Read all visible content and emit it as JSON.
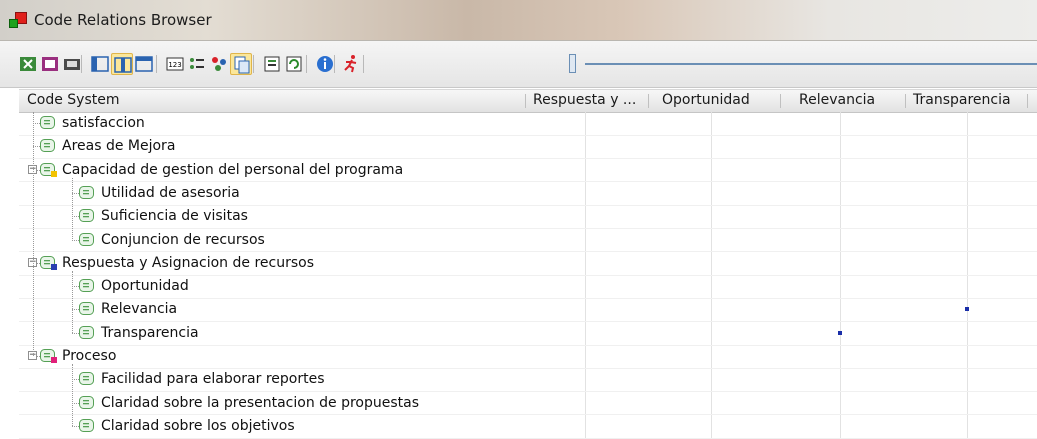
{
  "window": {
    "title": "Code Relations Browser"
  },
  "toolbar": {
    "buttons": [
      {
        "icon": "export-excel-icon"
      },
      {
        "icon": "export-icon"
      },
      {
        "icon": "print-icon"
      },
      {
        "icon": "layout-left-icon"
      },
      {
        "icon": "layout-center-icon",
        "active": true
      },
      {
        "icon": "layout-right-icon"
      },
      {
        "icon": "numbers-icon"
      },
      {
        "icon": "list-icon"
      },
      {
        "icon": "codes-icon"
      },
      {
        "icon": "copy-icon",
        "active": true
      },
      {
        "icon": "settings-list-icon"
      },
      {
        "icon": "refresh-icon"
      },
      {
        "icon": "info-icon"
      },
      {
        "icon": "runner-icon"
      }
    ]
  },
  "columns": {
    "code_system": "Code System",
    "c1": "Respuesta y ...",
    "c2": "Oportunidad",
    "c3": "Relevancia",
    "c4": "Transparencia"
  },
  "rows": [
    {
      "label": "satisfaccion",
      "level": 0,
      "color": "#55a055"
    },
    {
      "label": "Areas de Mejora",
      "level": 0,
      "color": "#55a055"
    },
    {
      "label": "Capacidad de gestion del personal del programa",
      "level": 0,
      "color": "#f2c200",
      "expandable": true
    },
    {
      "label": "Utilidad de asesoria",
      "level": 1,
      "color": "#55a055"
    },
    {
      "label": "Suficiencia de visitas",
      "level": 1,
      "color": "#55a055"
    },
    {
      "label": "Conjuncion de recursos",
      "level": 1,
      "color": "#55a055"
    },
    {
      "label": "Respuesta y Asignacion de recursos",
      "level": 0,
      "color": "#2a3fb0",
      "expandable": true
    },
    {
      "label": "Oportunidad",
      "level": 1,
      "color": "#55a055"
    },
    {
      "label": "Relevancia",
      "level": 1,
      "color": "#55a055"
    },
    {
      "label": "Transparencia",
      "level": 1,
      "color": "#55a055"
    },
    {
      "label": "Proceso",
      "level": 0,
      "color": "#e0207a",
      "expandable": true
    },
    {
      "label": "Facilidad para elaborar reportes",
      "level": 1,
      "color": "#55a055"
    },
    {
      "label": "Claridad sobre la presentacion de propuestas",
      "level": 1,
      "color": "#55a055"
    },
    {
      "label": "Claridad sobre los objetivos",
      "level": 1,
      "color": "#55a055"
    }
  ],
  "relations": [
    {
      "row": "Relevancia",
      "column": "Transparencia"
    },
    {
      "row": "Transparencia",
      "column": "Relevancia"
    }
  ]
}
